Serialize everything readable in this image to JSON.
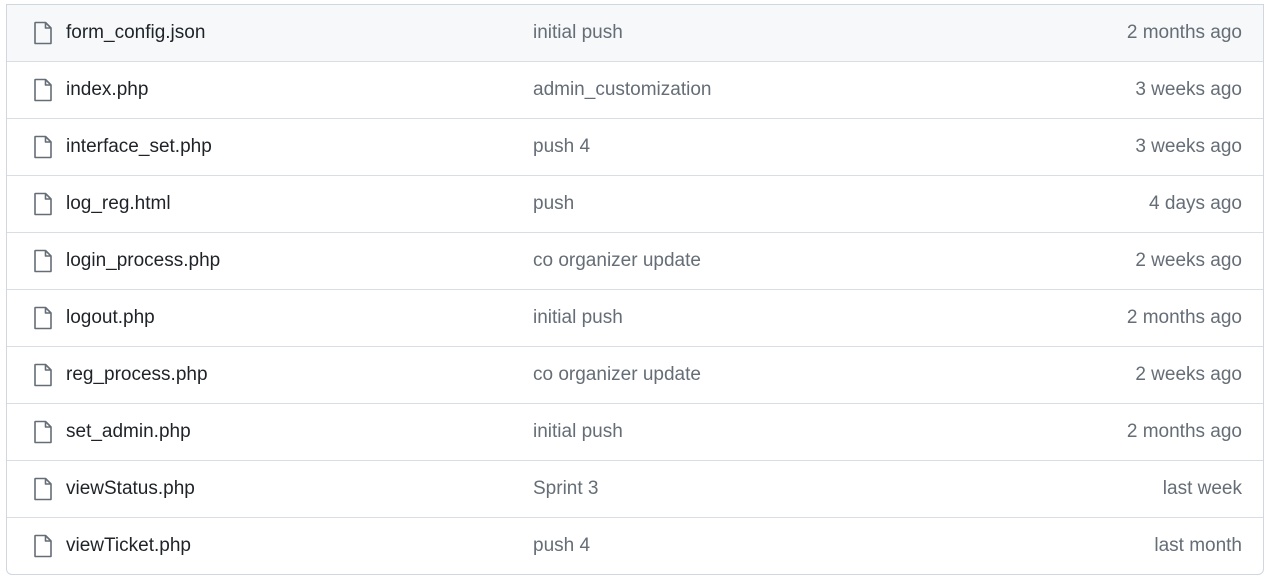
{
  "colors": {
    "border": "#d0d7de",
    "row_divider": "#d8dee4",
    "text_primary": "#1f2328",
    "text_muted": "#656d76",
    "icon": "#656d76",
    "highlight_row": "#f6f8fa"
  },
  "files": [
    {
      "icon": "file-icon",
      "name": "form_config.json",
      "commit_message": "initial push",
      "updated": "2 months ago"
    },
    {
      "icon": "file-icon",
      "name": "index.php",
      "commit_message": "admin_customization",
      "updated": "3 weeks ago"
    },
    {
      "icon": "file-icon",
      "name": "interface_set.php",
      "commit_message": "push 4",
      "updated": "3 weeks ago"
    },
    {
      "icon": "file-icon",
      "name": "log_reg.html",
      "commit_message": "push",
      "updated": "4 days ago"
    },
    {
      "icon": "file-icon",
      "name": "login_process.php",
      "commit_message": "co organizer update",
      "updated": "2 weeks ago"
    },
    {
      "icon": "file-icon",
      "name": "logout.php",
      "commit_message": "initial push",
      "updated": "2 months ago"
    },
    {
      "icon": "file-icon",
      "name": "reg_process.php",
      "commit_message": "co organizer update",
      "updated": "2 weeks ago"
    },
    {
      "icon": "file-icon",
      "name": "set_admin.php",
      "commit_message": "initial push",
      "updated": "2 months ago"
    },
    {
      "icon": "file-icon",
      "name": "viewStatus.php",
      "commit_message": "Sprint 3",
      "updated": "last week"
    },
    {
      "icon": "file-icon",
      "name": "viewTicket.php",
      "commit_message": "push 4",
      "updated": "last month"
    }
  ]
}
